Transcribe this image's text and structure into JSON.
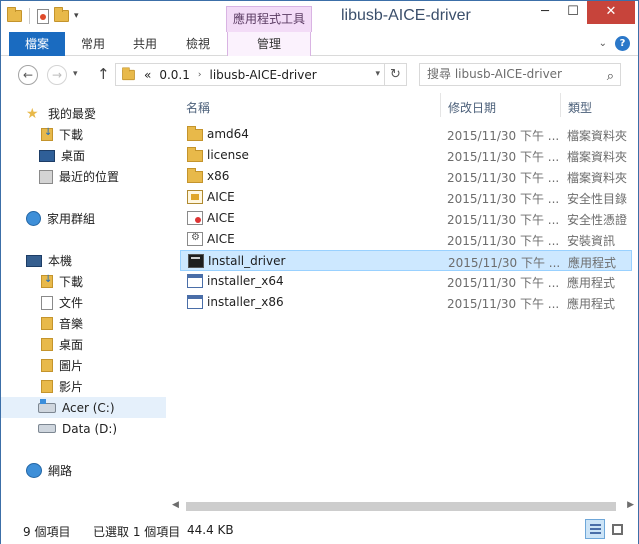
{
  "window": {
    "title": "libusb-AICE-driver",
    "controls": {
      "minimize": "─",
      "maximize": "☐",
      "close": "✕"
    }
  },
  "quick_access_toolbar": {
    "dropdown": "▾"
  },
  "ribbon": {
    "context_tab_group": "應用程式工具",
    "tabs": [
      "檔案",
      "常用",
      "共用",
      "檢視",
      "管理"
    ],
    "expand": "⌄",
    "help": "?"
  },
  "navigation": {
    "back": "←",
    "forward": "→",
    "recent_dropdown": "▾",
    "up": "↑",
    "breadcrumb": [
      "«",
      "0.0.1",
      "libusb-AICE-driver"
    ],
    "breadcrumb_separator": "›",
    "address_dropdown": "▾",
    "refresh": "↻",
    "search_placeholder": "搜尋 libusb-AICE-driver"
  },
  "nav_pane": {
    "favorites": {
      "label": "我的最愛",
      "items": [
        "下載",
        "桌面",
        "最近的位置"
      ]
    },
    "homegroup": "家用群組",
    "this_pc": {
      "label": "本機",
      "items": [
        "下載",
        "文件",
        "音樂",
        "桌面",
        "圖片",
        "影片",
        "Acer (C:)",
        "Data (D:)"
      ]
    },
    "network": "網路"
  },
  "file_list": {
    "columns": {
      "name": "名稱",
      "date": "修改日期",
      "type": "類型"
    },
    "sort_indicator": "^",
    "rows": [
      {
        "name": "amd64",
        "date": "2015/11/30 下午 ...",
        "type": "檔案資料夾",
        "icon": "folder-icon"
      },
      {
        "name": "license",
        "date": "2015/11/30 下午 ...",
        "type": "檔案資料夾",
        "icon": "folder-icon"
      },
      {
        "name": "x86",
        "date": "2015/11/30 下午 ...",
        "type": "檔案資料夾",
        "icon": "folder-icon"
      },
      {
        "name": "AICE",
        "date": "2015/11/30 下午 ...",
        "type": "安全性目錄",
        "icon": "security-catalog-icon"
      },
      {
        "name": "AICE",
        "date": "2015/11/30 下午 ...",
        "type": "安全性憑證",
        "icon": "security-certificate-icon"
      },
      {
        "name": "AICE",
        "date": "2015/11/30 下午 ...",
        "type": "安裝資訊",
        "icon": "setup-information-icon"
      },
      {
        "name": "Install_driver",
        "date": "2015/11/30 下午 ...",
        "type": "應用程式",
        "icon": "command-icon",
        "selected": true
      },
      {
        "name": "installer_x64",
        "date": "2015/11/30 下午 ...",
        "type": "應用程式",
        "icon": "application-icon"
      },
      {
        "name": "installer_x86",
        "date": "2015/11/30 下午 ...",
        "type": "應用程式",
        "icon": "application-icon"
      }
    ]
  },
  "scrollbar": {
    "left": "◀",
    "right": "▶"
  },
  "status_bar": {
    "item_count": "9 個項目",
    "selection": "已選取 1 個項目",
    "size": "44.4 KB"
  },
  "colors": {
    "accent": "#1a6bc0",
    "context_tab": "#f3dcf7",
    "selection": "#cde8ff",
    "close": "#c7443b"
  }
}
